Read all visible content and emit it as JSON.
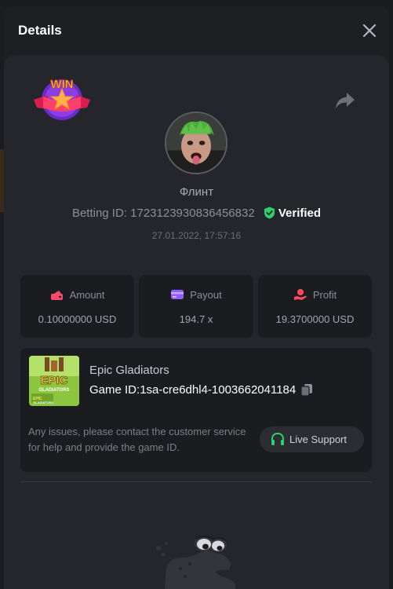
{
  "modal": {
    "title": "Details"
  },
  "bet": {
    "badge_text": "WIN",
    "username": "Флинт",
    "betting_id_label": "Betting ID:",
    "betting_id": "1723123930836456832",
    "verified_label": "Verified",
    "timestamp": "27.01.2022, 17:57:16"
  },
  "stats": {
    "amount": {
      "label": "Amount",
      "value": "0.10000000 USD",
      "icon": "wallet-icon",
      "color": "#ff4a6e"
    },
    "payout": {
      "label": "Payout",
      "value": "194.7 x",
      "icon": "card-icon",
      "color": "#8f5cff"
    },
    "profit": {
      "label": "Profit",
      "value": "19.3700000 USD",
      "icon": "money-hand-icon",
      "color": "#ff4a5e"
    }
  },
  "game": {
    "name": "Epic Gladiators",
    "id_label": "Game ID:",
    "id": "1sa-cre6dhl4-1003662041184",
    "thumb_title": "EPIC",
    "thumb_subtitle": "GLADIATORS"
  },
  "support": {
    "text": "Any issues, please contact the customer service for help and provide the game ID.",
    "button_label": "Live Support"
  },
  "colors": {
    "verified": "#2bd16a",
    "live_support_icon": "#2bd16a",
    "panel": "#25262b",
    "inner": "#1b1c20"
  }
}
